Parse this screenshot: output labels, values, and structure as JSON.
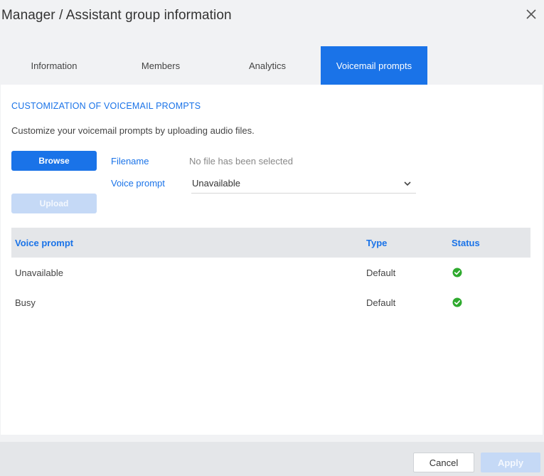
{
  "dialog": {
    "title": "Manager / Assistant group information",
    "close_icon": "close-icon"
  },
  "tabs": [
    {
      "label": "Information",
      "active": false
    },
    {
      "label": "Members",
      "active": false
    },
    {
      "label": "Analytics",
      "active": false
    },
    {
      "label": "Voicemail prompts",
      "active": true
    }
  ],
  "section": {
    "title": "CUSTOMIZATION OF VOICEMAIL PROMPTS",
    "description": "Customize your voicemail prompts by uploading audio files."
  },
  "upload_form": {
    "browse_label": "Browse",
    "upload_label": "Upload",
    "filename_label": "Filename",
    "filename_value": "No file has been selected",
    "voice_prompt_label": "Voice prompt",
    "voice_prompt_selected": "Unavailable"
  },
  "table": {
    "headers": [
      "Voice prompt",
      "Type",
      "Status"
    ],
    "rows": [
      {
        "voice_prompt": "Unavailable",
        "type": "Default",
        "status": "ok"
      },
      {
        "voice_prompt": "Busy",
        "type": "Default",
        "status": "ok"
      }
    ]
  },
  "footer": {
    "cancel_label": "Cancel",
    "apply_label": "Apply"
  },
  "colors": {
    "accent": "#1a73e8",
    "disabled": "#c5d9f6",
    "status_ok": "#2eaa2e"
  }
}
